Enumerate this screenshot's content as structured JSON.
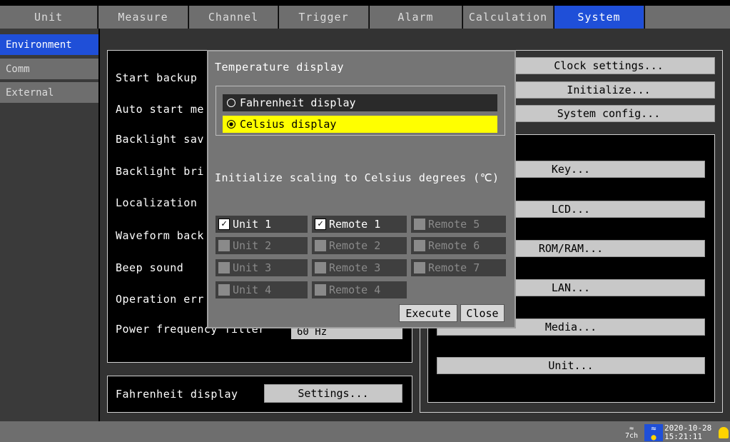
{
  "tabs": [
    "Unit",
    "Measure",
    "Channel",
    "Trigger",
    "Alarm",
    "Calculation",
    "System"
  ],
  "sidebar": [
    "Environment",
    "Comm",
    "External"
  ],
  "settings_labels": [
    "Start backup",
    "Auto start me",
    "Backlight sav",
    "Backlight bri",
    "Localization",
    "Waveform back",
    "Beep sound",
    "Operation err",
    "Power frequency filter"
  ],
  "power_freq_value": "60 Hz",
  "fahrenheit_label": "Fahrenheit display",
  "fahrenheit_settings_btn": "Settings...",
  "right_buttons_top": [
    "Clock settings...",
    "Initialize...",
    "System config..."
  ],
  "right_buttons_group": [
    "Key...",
    "LCD...",
    "ROM/RAM...",
    "LAN...",
    "Media...",
    "Unit..."
  ],
  "dialog": {
    "title": "Temperature display",
    "options": [
      "Fahrenheit display",
      "Celsius display"
    ],
    "selected": "Celsius display",
    "init_text": "Initialize scaling to Celsius degrees (℃)",
    "checkboxes": [
      {
        "label": "Unit 1",
        "checked": true,
        "enabled": true
      },
      {
        "label": "Remote 1",
        "checked": true,
        "enabled": true
      },
      {
        "label": "Remote 5",
        "checked": false,
        "enabled": false
      },
      {
        "label": "Unit 2",
        "checked": false,
        "enabled": false
      },
      {
        "label": "Remote 2",
        "checked": false,
        "enabled": false
      },
      {
        "label": "Remote 6",
        "checked": false,
        "enabled": false
      },
      {
        "label": "Unit 3",
        "checked": false,
        "enabled": false
      },
      {
        "label": "Remote 3",
        "checked": false,
        "enabled": false
      },
      {
        "label": "Remote 7",
        "checked": false,
        "enabled": false
      },
      {
        "label": "Unit 4",
        "checked": false,
        "enabled": false
      },
      {
        "label": "Remote 4",
        "checked": false,
        "enabled": false
      }
    ],
    "execute": "Execute",
    "close": "Close"
  },
  "status": {
    "channel": "7ch",
    "date": "2020-10-28",
    "time": "15:21:11"
  }
}
